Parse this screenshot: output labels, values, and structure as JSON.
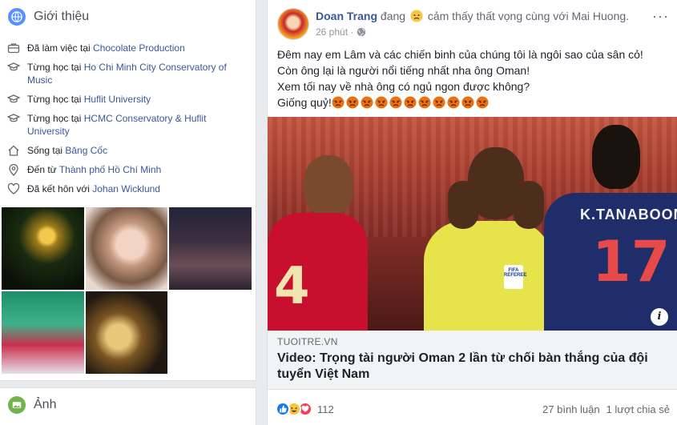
{
  "intro": {
    "title": "Giới thiệu",
    "items": [
      {
        "icon": "briefcase-icon",
        "prefix": "Đã làm việc tại ",
        "link": "Chocolate Production",
        "suffix": ""
      },
      {
        "icon": "graduation-cap-icon",
        "prefix": "Từng học tại ",
        "link": "Ho Chi Minh City Conservatory of Music",
        "suffix": ""
      },
      {
        "icon": "graduation-cap-icon",
        "prefix": "Từng học tại ",
        "link": "Huflit University",
        "suffix": ""
      },
      {
        "icon": "graduation-cap-icon",
        "prefix": "Từng học tại ",
        "link": "HCMC Conservatory & Huflit University",
        "suffix": ""
      },
      {
        "icon": "home-icon",
        "prefix": "Sống tại ",
        "link": "Băng Cốc",
        "suffix": ""
      },
      {
        "icon": "location-pin-icon",
        "prefix": "Đến từ ",
        "link": "Thành phố Hồ Chí Minh",
        "suffix": ""
      },
      {
        "icon": "heart-icon",
        "prefix": "Đã kết hôn với ",
        "link": "Johan Wicklund",
        "suffix": ""
      }
    ]
  },
  "photos": {
    "title": "Ảnh"
  },
  "post": {
    "author": "Doan Trang",
    "feeling_prefix": "đang",
    "feeling_text": "cảm thấy thất vọng cùng với Mai Huong.",
    "time": "26 phút ·",
    "more": "···",
    "lines": [
      "Đêm nay em Lâm và các chiến binh của chúng tôi là ngôi sao của sân cỏ!",
      "Còn ông lại là người nổi tiếng nhất nha ông Oman!",
      "Xem tối nay về nhà ông có ngủ ngon được không?",
      "Giống quỷ!"
    ],
    "angry_count": 11,
    "link": {
      "domain": "TUOITRE.VN",
      "title": "Video: Trọng tài người Oman 2 lần từ chối bàn thắng của đội tuyển Việt Nam",
      "jersey_left": "4",
      "jersey_right_name": "K.TANABOON",
      "jersey_right_num": "17",
      "badge": "FIFA REFEREE",
      "info": "i"
    },
    "reactions_count": "112",
    "comments": "27 bình luận",
    "shares": "1 lượt chia sẻ"
  },
  "colors": {
    "link": "#385898",
    "fb_blue": "#1877f2",
    "angry": "#e9710f"
  }
}
